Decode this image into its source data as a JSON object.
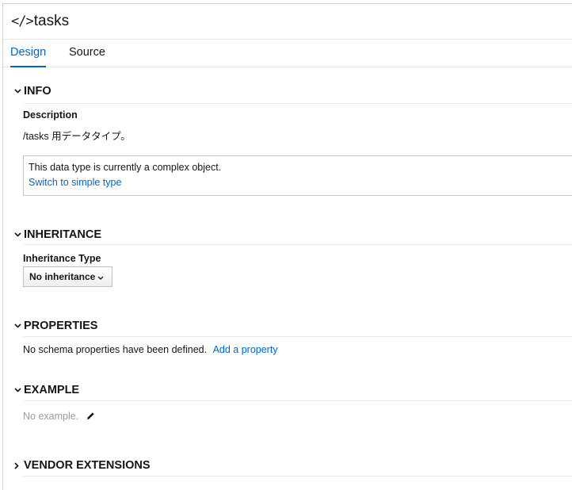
{
  "header": {
    "icon": "code-icon",
    "icon_glyph": "</>",
    "title": "tasks"
  },
  "tabs": [
    {
      "label": "Design",
      "active": true
    },
    {
      "label": "Source",
      "active": false
    }
  ],
  "info": {
    "title": "INFO",
    "description_label": "Description",
    "description_value": "/tasks 用データタイプ。",
    "notice_text": "This data type is currently a complex object.",
    "notice_link": "Switch to simple type"
  },
  "inheritance": {
    "title": "INHERITANCE",
    "type_label": "Inheritance Type",
    "type_value": "No inheritance"
  },
  "properties": {
    "title": "PROPERTIES",
    "empty_text": "No schema properties have been defined.",
    "add_link": "Add a property"
  },
  "example": {
    "title": "EXAMPLE",
    "empty_text": "No example."
  },
  "vendor_extensions": {
    "title": "VENDOR EXTENSIONS",
    "expanded": false
  },
  "colors": {
    "accent": "#0066cc",
    "text": "#151515",
    "muted": "#9a9a9a",
    "border": "#d2d2d2"
  }
}
